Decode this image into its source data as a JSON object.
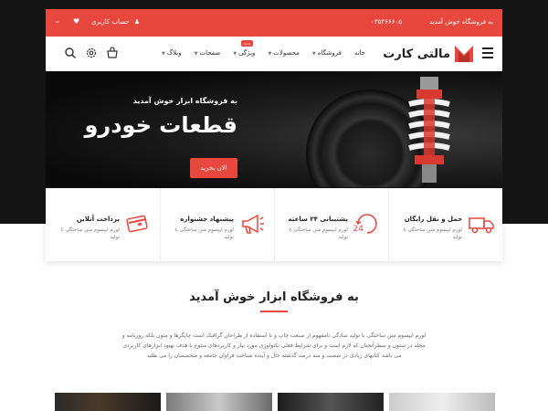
{
  "topbar": {
    "welcome": "به فروشگاه خوش آمدید",
    "phone": "۰۳۵۳۶۶۶۰۵",
    "account": "حساب کاربری",
    "account_icon": "user-icon",
    "wishlist_icon": "heart-icon",
    "lang_icon": "chevron-down-icon"
  },
  "nav": {
    "logo_text": "مالتی کارت",
    "items": [
      {
        "label": "خانه",
        "has_caret": false
      },
      {
        "label": "فروشگاه",
        "has_caret": true
      },
      {
        "label": "محصولات",
        "has_caret": true
      },
      {
        "label": "ویژگی",
        "has_caret": true,
        "badge": "جدید"
      },
      {
        "label": "صفحات",
        "has_caret": true
      },
      {
        "label": "وبلاگ",
        "has_caret": true
      }
    ],
    "icons": [
      "search-icon",
      "gear-icon",
      "cart-icon"
    ]
  },
  "hero": {
    "subtitle": "به فروشگاه ابزار خوش آمدید",
    "title": "قطعات خودرو",
    "button": "الان بخرید"
  },
  "features": [
    {
      "title": "حمل و نقل رایگان",
      "desc": "لورم ایپسوم متن ساختگی با تولید",
      "icon": "truck-icon"
    },
    {
      "title": "پشتیبانی ۲۴ ساعته",
      "desc": "لورم ایپسوم متن ساختگی با تولید",
      "icon": "support-24-icon"
    },
    {
      "title": "پیشنهاد جشنواره",
      "desc": "لورم ایپسوم متن ساختگی با تولید",
      "icon": "megaphone-icon"
    },
    {
      "title": "پرداخت آنلاین",
      "desc": "لورم ایپسوم متن ساختگی با تولید",
      "icon": "credit-card-icon"
    }
  ],
  "welcome": {
    "title": "به فروشگاه ابزار خوش آمدید",
    "text": "لورم ایپسوم متن ساختگی با تولید سادگی نامفهوم از صنعت چاپ و با استفاده از طراحان گرافیک است چاپگرها و متون بلکه روزنامه و مجله در ستون و سطرآنچنان که لازم است و برای شرایط فعلی تکنولوژی مورد نیاز و کاربردهای متنوع با هدف بهبود ابزارهای کاربردی می باشد کتابهای زیادی در شصت و سه درصد گذشته حال و آینده شناخت فراوان جامعه و متخصصان را می طلبد"
  },
  "colors": {
    "accent": "#e8473d",
    "dark": "#141414"
  }
}
